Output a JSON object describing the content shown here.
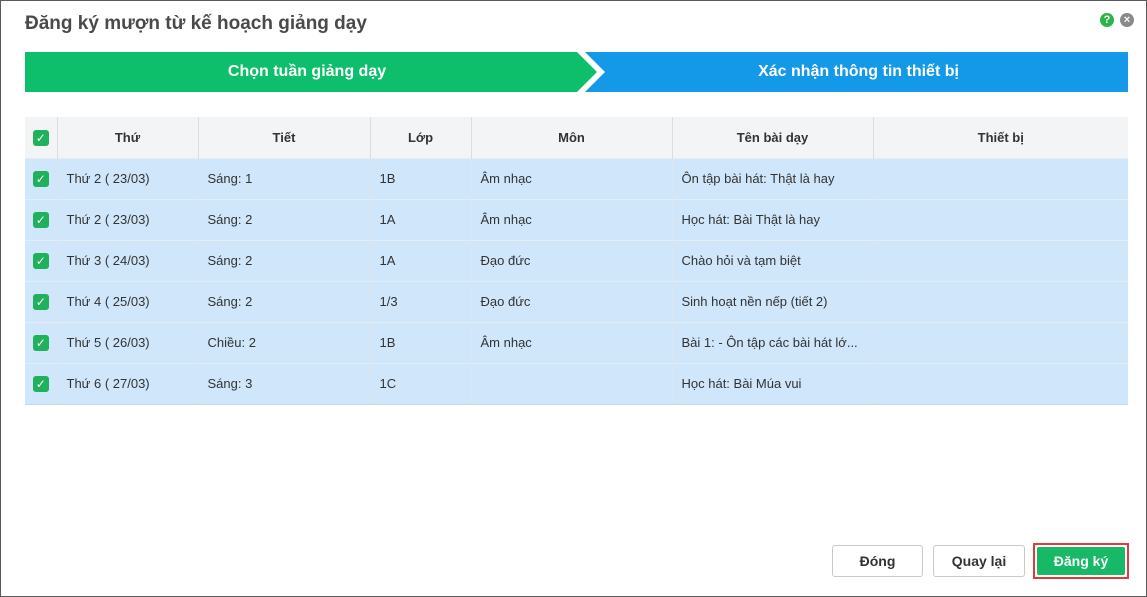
{
  "dialog": {
    "title": "Đăng ký mượn từ kế hoạch giảng dạy",
    "help_icon": "?",
    "close_icon": "×"
  },
  "steps": [
    {
      "label": "Chọn tuần giảng dạy",
      "color": "#0dbf6a",
      "active": true
    },
    {
      "label": "Xác nhận thông tin thiết bị",
      "color": "#1498e8",
      "active": false
    }
  ],
  "table": {
    "headers": [
      "Thứ",
      "Tiết",
      "Lớp",
      "Môn",
      "Tên bài dạy",
      "Thiết bị"
    ],
    "rows": [
      {
        "checked": true,
        "day": "Thứ 2 ( 23/03)",
        "period": "Sáng: 1",
        "class": "1B",
        "subject": "Âm nhạc",
        "lesson": "Ôn tập bài hát: Thật là hay",
        "device": ""
      },
      {
        "checked": true,
        "day": "Thứ 2 ( 23/03)",
        "period": "Sáng: 2",
        "class": "1A",
        "subject": "Âm nhạc",
        "lesson": "Học hát: Bài Thật là hay",
        "device": ""
      },
      {
        "checked": true,
        "day": "Thứ 3 ( 24/03)",
        "period": "Sáng: 2",
        "class": "1A",
        "subject": "Đạo đức",
        "lesson": "Chào hỏi và tạm biệt",
        "device": ""
      },
      {
        "checked": true,
        "day": "Thứ 4 ( 25/03)",
        "period": "Sáng: 2",
        "class": "1/3",
        "subject": "Đạo đức",
        "lesson": "Sinh hoạt nền nếp (tiết 2)",
        "device": ""
      },
      {
        "checked": true,
        "day": "Thứ 5 ( 26/03)",
        "period": "Chiều: 2",
        "class": "1B",
        "subject": "Âm nhạc",
        "lesson": "Bài 1: - Ôn tập các bài hát lớ...",
        "device": ""
      },
      {
        "checked": true,
        "day": "Thứ 6 ( 27/03)",
        "period": "Sáng: 3",
        "class": "1C",
        "subject": "",
        "lesson": "Học hát: Bài Múa vui",
        "device": ""
      }
    ]
  },
  "footer": {
    "close_label": "Đóng",
    "back_label": "Quay lại",
    "register_label": "Đăng ký"
  },
  "colors": {
    "selected_row": "#cfe6fb",
    "checkbox": "#1fb25a",
    "register_button": "#17b866",
    "highlight_border": "#e0393e"
  }
}
